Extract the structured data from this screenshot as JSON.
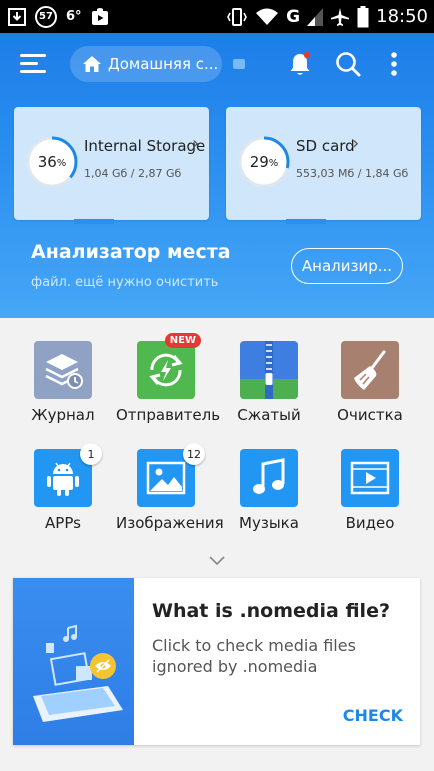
{
  "status_bar": {
    "badge": "57",
    "temp": "6°",
    "network": "G",
    "time": "18:50"
  },
  "toolbar": {
    "path_label": "Домашняя с..."
  },
  "storage": [
    {
      "title": "Internal Storage",
      "percent": "36",
      "percent_sign": "%",
      "sizes": "1,04 Gб / 2,87 Gб",
      "fill": 0.36
    },
    {
      "title": "SD card",
      "percent": "29",
      "percent_sign": "%",
      "sizes": "553,03 Мб / 1,84 Gб",
      "fill": 0.29
    }
  ],
  "analyzer": {
    "title": "Анализатор места",
    "subtitle": "файл. ещё нужно очистить",
    "button": "Анализир..."
  },
  "grid": [
    {
      "label": "Журнал",
      "icon": "history-icon",
      "color": "#8fa2c4"
    },
    {
      "label": "Отправитель",
      "icon": "sender-icon",
      "color": "#4fb84f",
      "new": "NEW"
    },
    {
      "label": "Сжатый",
      "icon": "zip-icon",
      "color": "#3d7ee0"
    },
    {
      "label": "Очистка",
      "icon": "broom-icon",
      "color": "#a88070"
    },
    {
      "label": "APPs",
      "icon": "android-icon",
      "color": "#2196f3",
      "count": "1"
    },
    {
      "label": "Изображения",
      "icon": "image-icon",
      "color": "#2196f3",
      "count": "12"
    },
    {
      "label": "Музыка",
      "icon": "music-icon",
      "color": "#2196f3"
    },
    {
      "label": "Видео",
      "icon": "video-icon",
      "color": "#2196f3"
    }
  ],
  "promo": {
    "title": "What is .nomedia file?",
    "description": "Click to check media files ignored by .nomedia",
    "action": "CHECK"
  },
  "colors": {
    "accent": "#1e88e5",
    "header": "#2b8ff0",
    "ring": "#1e88e5"
  }
}
